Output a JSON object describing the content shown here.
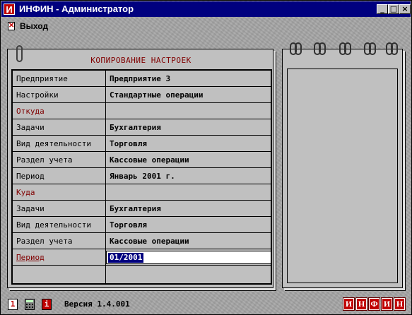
{
  "window": {
    "app_icon": "И",
    "title": "ИНФИН - Администратор",
    "minimize": "_",
    "maximize": "□",
    "close": "×"
  },
  "menu": {
    "exit_label": "Выход",
    "exit_icon": "exit-icon"
  },
  "panel": {
    "title": "КОПИРОВАНИЕ НАСТРОЕК",
    "rows": [
      {
        "label": "Предприятие",
        "value": "Предприятие 3"
      },
      {
        "label": "Настройки",
        "value": "Стандартные операции"
      },
      {
        "label": "Откуда",
        "value": ""
      },
      {
        "label": "Задачи",
        "value": "Бухгалтерия"
      },
      {
        "label": "Вид деятельности",
        "value": "Торговля"
      },
      {
        "label": "Раздел учета",
        "value": "Кассовые операции"
      },
      {
        "label": "Период",
        "value": "Январь 2001 г."
      },
      {
        "label": "Куда",
        "value": ""
      },
      {
        "label": "Задачи",
        "value": "Бухгалтерия"
      },
      {
        "label": "Вид деятельности",
        "value": "Торговля"
      },
      {
        "label": "Раздел учета",
        "value": "Кассовые операции"
      },
      {
        "label": "Период",
        "value": "01/2001"
      },
      {
        "label": "",
        "value": ""
      }
    ]
  },
  "status": {
    "icon1": "1",
    "icon2": "calculator-icon",
    "icon3": "i",
    "version": "Версия 1.4.001",
    "logo": [
      "И",
      "Н",
      "Ф",
      "И",
      "Н"
    ]
  },
  "colors": {
    "titlebar": "#00007f",
    "accent_red": "#800000",
    "logo_red": "#c00000",
    "selection": "#00007f"
  }
}
